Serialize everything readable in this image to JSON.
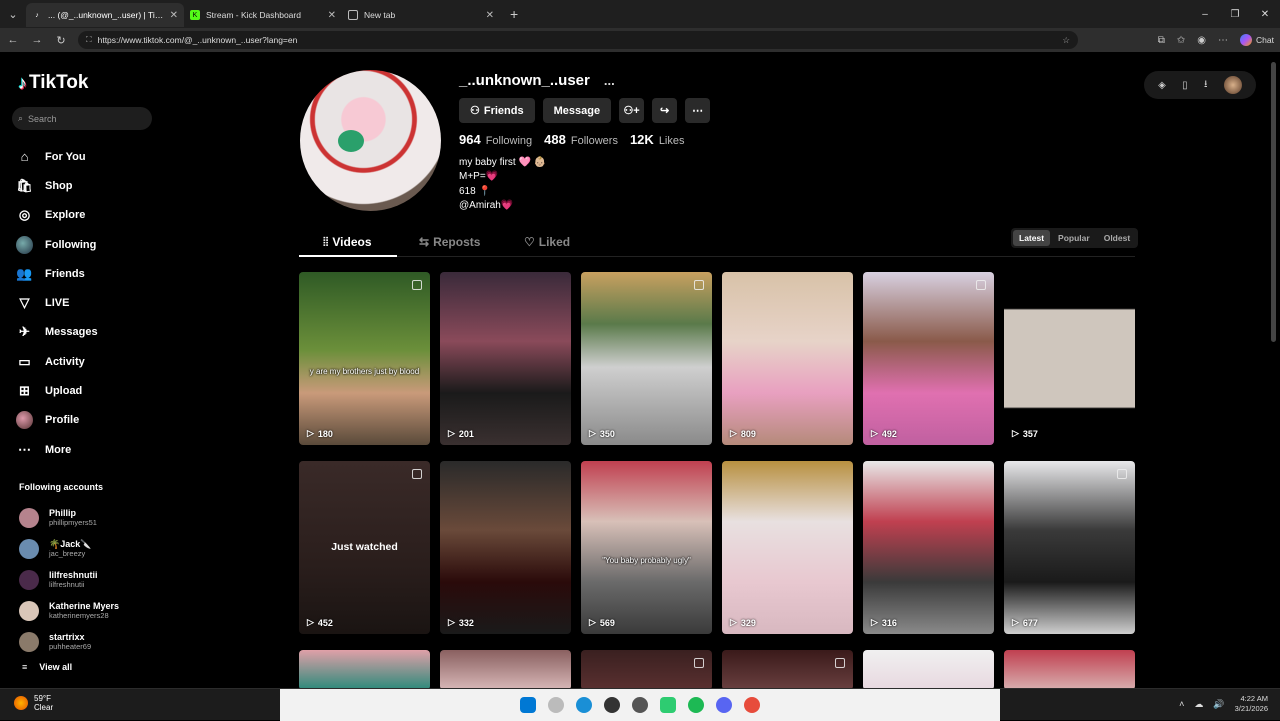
{
  "browser": {
    "tabs": [
      {
        "title": "... (@_..unknown_..user) | TikTok",
        "active": true,
        "icon": "tiktok-icon"
      },
      {
        "title": "Stream - Kick Dashboard",
        "active": false,
        "icon": "kick-icon"
      },
      {
        "title": "New tab",
        "active": false,
        "icon": "newtab-icon"
      }
    ],
    "new_tab": "+",
    "url": "https://www.tiktok.com/@_..unknown_..user?lang=en",
    "chat_label": "Chat",
    "window_controls": [
      "–",
      "❐",
      "✕"
    ]
  },
  "sidebar": {
    "logo_text": "TikTok",
    "search_placeholder": "Search",
    "nav": [
      {
        "label": "For You",
        "icon": "home-icon"
      },
      {
        "label": "Shop",
        "icon": "shop-icon"
      },
      {
        "label": "Explore",
        "icon": "compass-icon"
      },
      {
        "label": "Following",
        "icon": "following-avatar"
      },
      {
        "label": "Friends",
        "icon": "friends-icon"
      },
      {
        "label": "LIVE",
        "icon": "live-icon"
      },
      {
        "label": "Messages",
        "icon": "messages-icon"
      },
      {
        "label": "Activity",
        "icon": "activity-icon"
      },
      {
        "label": "Upload",
        "icon": "upload-icon"
      },
      {
        "label": "Profile",
        "icon": "profile-avatar"
      },
      {
        "label": "More",
        "icon": "more-icon"
      }
    ],
    "following_title": "Following accounts",
    "following": [
      {
        "name": "Phillip",
        "handle": "phillipmyers51",
        "color": "#b5838d"
      },
      {
        "name": "🌴Jack🔪",
        "handle": "jac_breezy",
        "color": "#6a8caf"
      },
      {
        "name": "lilfreshnutii",
        "handle": "lilfreshnutii",
        "color": "#4a2a4a"
      },
      {
        "name": "Katherine Myers",
        "handle": "katherinemyers28",
        "color": "#d9c6b8"
      },
      {
        "name": "startrixx",
        "handle": "puhheater69",
        "color": "#8a7a6a"
      }
    ],
    "view_all": "View all"
  },
  "profile": {
    "username": "_..unknown_..user",
    "more": "...",
    "buttons": {
      "friends": "Friends",
      "message": "Message"
    },
    "stats": [
      {
        "value": "964",
        "label": "Following"
      },
      {
        "value": "488",
        "label": "Followers"
      },
      {
        "value": "12K",
        "label": "Likes"
      }
    ],
    "bio": [
      "my baby first 🩷 👶🏼",
      "M+P=💗",
      "618 📍",
      "@Amirah💗"
    ],
    "tabs": [
      "Videos",
      "Reposts",
      "Liked"
    ],
    "sort": [
      "Latest",
      "Popular",
      "Oldest"
    ]
  },
  "videos": [
    {
      "views": "180",
      "caption": "y are my brothers just by blood",
      "bg": "linear-gradient(180deg,#2f5a25,#6b8f3a 45%,#c99a7a 70%,#5a4a3a)"
    },
    {
      "views": "201",
      "caption": "",
      "bg": "linear-gradient(180deg,#3a2a3a,#8a4a5a 40%,#1a1a1a 70%,#3a3030)"
    },
    {
      "views": "350",
      "caption": "",
      "bg": "linear-gradient(180deg,#c8a060,#5a7a4a 30%,#cfcfcf 55%,#8a8a8a)"
    },
    {
      "views": "809",
      "caption": "",
      "bg": "linear-gradient(180deg,#d8c2a8,#e7d3c8 40%,#e8a0c0 70%,#b58a7a)"
    },
    {
      "views": "492",
      "caption": "",
      "bg": "linear-gradient(180deg,#d8d0e0,#8a5a4a 40%,#e070b0 70%,#c060a0)"
    },
    {
      "views": "357",
      "caption": "",
      "bg": "linear-gradient(180deg,#000 0 21%,#cfc6bd 22% 78%,#000 79%)"
    },
    {
      "views": "452",
      "caption": "Just watched",
      "bg": "linear-gradient(180deg,#3a2a28,#2a1e1c 60%,#1a1412)"
    },
    {
      "views": "332",
      "caption": "",
      "bg": "linear-gradient(180deg,#2a2a2a,#6a4a3a 40%,#2a0a0a 70%,#1a1a1a)"
    },
    {
      "views": "569",
      "caption": "\"You baby probably ugly\"",
      "bg": "linear-gradient(180deg,#c04050,#d8c0b8 35%,#6a6a6a 70%,#3a3a3a)"
    },
    {
      "views": "329",
      "caption": "",
      "bg": "linear-gradient(180deg,#b89040,#e8e0e0 35%,#e8c8d0 70%,#d8b8c0)"
    },
    {
      "views": "316",
      "caption": "",
      "bg": "linear-gradient(180deg,#e8e8e8,#c04050 35%,#3a3a3a 70%,#8a8a8a)"
    },
    {
      "views": "677",
      "caption": "",
      "bg": "linear-gradient(180deg,#e8e8ea,#3a3a3a 40%,#1a1a1a 70%,#cfcfcf)"
    },
    {
      "views": "",
      "caption": "",
      "bg": "linear-gradient(180deg,#e0a0a8,#2a8a7a)"
    },
    {
      "views": "",
      "caption": "",
      "bg": "linear-gradient(180deg,#8a6060,#d8b8b8)"
    },
    {
      "views": "",
      "caption": "",
      "bg": "linear-gradient(180deg,#3a2020,#5a3030)"
    },
    {
      "views": "",
      "caption": "",
      "bg": "linear-gradient(180deg,#3a1a1a,#6a4040)"
    },
    {
      "views": "",
      "caption": "",
      "bg": "linear-gradient(180deg,#f0f0f0,#e8d8e0)"
    },
    {
      "views": "",
      "caption": "",
      "bg": "linear-gradient(180deg,#c04050,#d8b0b0)"
    }
  ],
  "taskbar": {
    "temp": "59°F",
    "condition": "Clear",
    "time": "4:22 AM",
    "date": "3/21/2026"
  }
}
